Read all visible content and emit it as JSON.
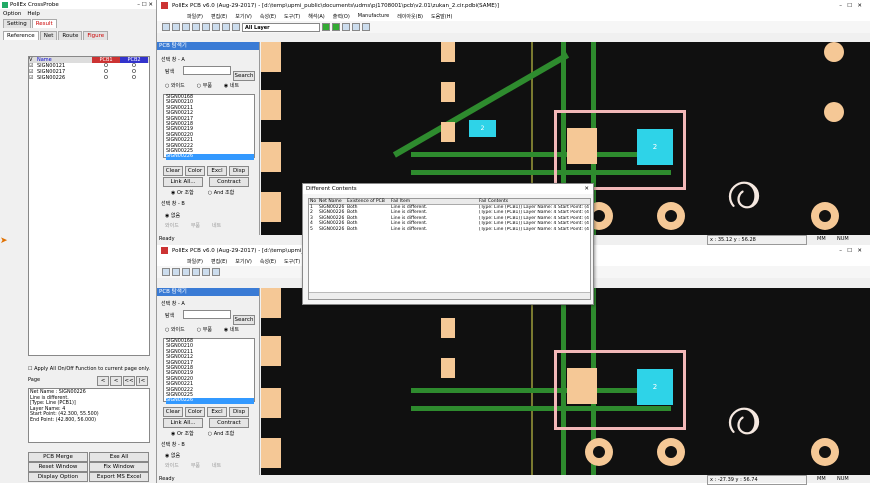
{
  "probe": {
    "title": "PollEx CrossProbe",
    "menu": [
      "Option",
      "Help"
    ],
    "outer_tabs": [
      "Setting",
      "Result"
    ],
    "inner_tabs": [
      "Reference",
      "Net",
      "Route",
      "Figure"
    ],
    "columns": [
      "V",
      "Name",
      "PCB1",
      "PCB2"
    ],
    "rows": [
      {
        "name": "SIGN00121",
        "a": "O",
        "b": "O"
      },
      {
        "name": "SIGN00217",
        "a": "O",
        "b": "O"
      },
      {
        "name": "SIGN00226",
        "a": "O",
        "b": "O"
      }
    ],
    "apply_label": "Apply All On/Off Function to current page only.",
    "page_label": "Page",
    "page_btns": [
      "<",
      "<",
      "<<",
      "|<"
    ],
    "detail": [
      "Net Name : SIGN00226",
      "",
      "Line is different.",
      "[Type: Line (PCB1)]",
      "Layer Name: 4",
      "Start Point: (42.300, 55.500)",
      "End Point: (42.800, 56.000)"
    ],
    "bottom": [
      "PCB Merge",
      "Exe All",
      "Reset Window",
      "Fix Window",
      "Display Option",
      "Export MS Excel"
    ]
  },
  "win1": {
    "title": "PollEx PCB v6.0 (Aug-29-2017) - [d:\\temp\\upmi_public\\documents\\udms\\pj1708001\\pcb\\v2.01\\zukan_2.cir.pdbi(SAME)]",
    "menu": [
      "파일(F)",
      "편집(E)",
      "보기(V)",
      "속성(E)",
      "도구(T)",
      "해석(A)",
      "출력(O)",
      "Manufacture",
      "레이아웃(B)",
      "도움말(H)"
    ],
    "layer": "All Layer",
    "panel_title": "PCB 탐색기",
    "group_a": "선택 창 - A",
    "search_label": "탐색",
    "search_btn": "Search",
    "radio": [
      "와이드",
      "부품",
      "네트"
    ],
    "nets": [
      "SIGN00168",
      "SIGN00210",
      "SIGN00211",
      "SIGN00212",
      "SIGN00217",
      "SIGN00218",
      "SIGN00219",
      "SIGN00220",
      "SIGN00221",
      "SIGN00222",
      "SIGN00225",
      "SIGN00226"
    ],
    "btns": [
      "Clear",
      "Color",
      "Excl",
      "Disp",
      "Link All...",
      "Contract"
    ],
    "or": "Or 조합",
    "and": "And 조합",
    "group_b": "선택 창 - B",
    "all": "없음",
    "rb": [
      "와이드",
      "부품",
      "네트"
    ],
    "status": "Ready",
    "coord": "x : 35.12  y : 56.28",
    "mm": "MM",
    "num": "NUM",
    "pad_num": "2"
  },
  "win2": {
    "title": "PollEx PCB v6.0 (Aug-29-2017) - [d:\\temp\\upmi_pu",
    "coord": "x : -27.39  y : 56.74",
    "status": "Ready",
    "pad_num": "2"
  },
  "dialog": {
    "title": "Different Contents",
    "columns": [
      "No",
      "Net Name",
      "Existence of PCB",
      "Fail Item",
      "Fail Contents"
    ],
    "rows": [
      [
        "1",
        "SIGN00226",
        "Both",
        "Line is different.",
        "[Type: Line (PCB1)] Layer Name: 4 Start Point: (42"
      ],
      [
        "2",
        "SIGN00226",
        "Both",
        "Line is different.",
        "[Type: Line (PCB1)] Layer Name: 4 Start Point: (42"
      ],
      [
        "3",
        "SIGN00226",
        "Both",
        "Line is different.",
        "[Type: Line (PCB1)] Layer Name: 4 Start Point: (42"
      ],
      [
        "4",
        "SIGN00226",
        "Both",
        "Line is different.",
        "[Type: Line (PCB1)] Layer Name: 4 Start Point: (42"
      ],
      [
        "5",
        "SIGN00226",
        "Both",
        "Line is different.",
        "[Type: Line (PCB1)] Layer Name: 4 Start Point: (42"
      ]
    ]
  }
}
